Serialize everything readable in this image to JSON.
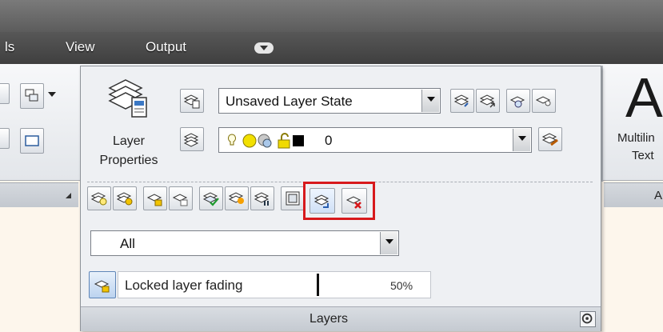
{
  "ribbon_tabs": [
    "ls",
    "View",
    "Output"
  ],
  "layers_panel": {
    "layer_properties_label_1": "Layer",
    "layer_properties_label_2": "Properties",
    "layer_state_value": "Unsaved Layer State",
    "current_layer_value": "0",
    "filter_value": "All",
    "locked_fading_label": "Locked layer fading",
    "locked_fading_value": "50%",
    "locked_fading_level": 0.5,
    "panel_title": "Layers",
    "highlight_color": "#d7191c"
  },
  "annotation_panel": {
    "big_glyph": "A",
    "mtext_label_1": "Multilin",
    "mtext_label_2": "Text",
    "panel_title_fragment": "A"
  },
  "icons": {
    "tool_row": [
      "layer-off-icon",
      "layer-isolate-icon",
      "layer-lock-icon",
      "layer-unlock-icon",
      "make-current-icon",
      "layer-match-icon",
      "layer-walk-icon",
      "viewport-freeze-icon",
      "layer-merge-icon",
      "layer-delete-icon"
    ]
  }
}
